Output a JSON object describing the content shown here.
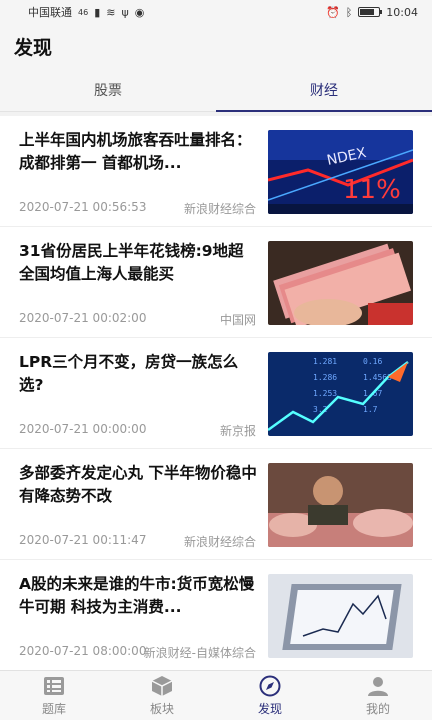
{
  "status_bar": {
    "carrier": "中国联通",
    "signal": "46",
    "time": "10:04",
    "battery_level": 0.8
  },
  "header": {
    "title": "发现"
  },
  "tabs": [
    {
      "label": "股票",
      "active": false
    },
    {
      "label": "财经",
      "active": true
    }
  ],
  "articles": [
    {
      "title": "上半年国内机场旅客吞吐量排名：成都排第一 首都机场...",
      "date": "2020-07-21 00:56:53",
      "source": "新浪财经综合",
      "image": "stock-ticker-board"
    },
    {
      "title": "31省份居民上半年花钱榜:9地超全国均值上海人最能买",
      "date": "2020-07-21 00:02:00",
      "source": "中国网",
      "image": "banknotes-in-hand"
    },
    {
      "title": "LPR三个月不变，房贷一族怎么选?",
      "date": "2020-07-21 00:00:00",
      "source": "新京报",
      "image": "rising-stock-chart"
    },
    {
      "title": "多部委齐发定心丸 下半年物价稳中有降态势不改",
      "date": "2020-07-21 00:11:47",
      "source": "新浪财经综合",
      "image": "pork-market-vendor"
    },
    {
      "title": "A股的未来是谁的牛市:货币宽松慢牛可期 科技为主消费...",
      "date": "2020-07-21 08:00:00",
      "source": "新浪财经-自媒体综合",
      "image": "puzzle-chart"
    }
  ],
  "bottom_nav": [
    {
      "label": "题库",
      "icon": "question-bank-icon",
      "active": false
    },
    {
      "label": "板块",
      "icon": "cube-icon",
      "active": false
    },
    {
      "label": "发现",
      "icon": "compass-icon",
      "active": true
    },
    {
      "label": "我的",
      "icon": "user-icon",
      "active": false
    }
  ],
  "colors": {
    "accent": "#2b2f7a",
    "text_secondary": "#999999",
    "background": "#f2f2f2"
  }
}
